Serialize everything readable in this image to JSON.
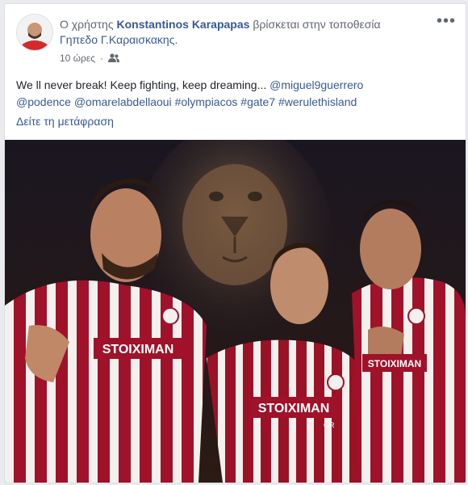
{
  "post": {
    "header": {
      "prefix": "Ο χρήστης",
      "author": "Konstantinos Karapapas",
      "middle": "βρίσκεται στην τοποθεσία",
      "location": "Γηπεδο Γ.Καραισκακης.",
      "time": "10 ώρες",
      "menu_icon": "more-dots-icon",
      "privacy_icon": "friends-icon"
    },
    "text": {
      "line1_plain": "We ll never break! Keep fighting, keep dreaming... ",
      "mention1": "@miguel9guerrero",
      "mention2": "@podence",
      "mention3": "@omarelabdellaoui",
      "hashtag1": "#olympiacos",
      "hashtag2": "#gate7",
      "hashtag3": "#werulethisland"
    },
    "translate": "Δείτε τη μετάφραση",
    "photo": {
      "sponsor_left": "STOIXIMAN",
      "sponsor_center": "STOIXIMAN",
      "sponsor_right": "STOIXIMAN",
      "gr": "GR"
    }
  }
}
